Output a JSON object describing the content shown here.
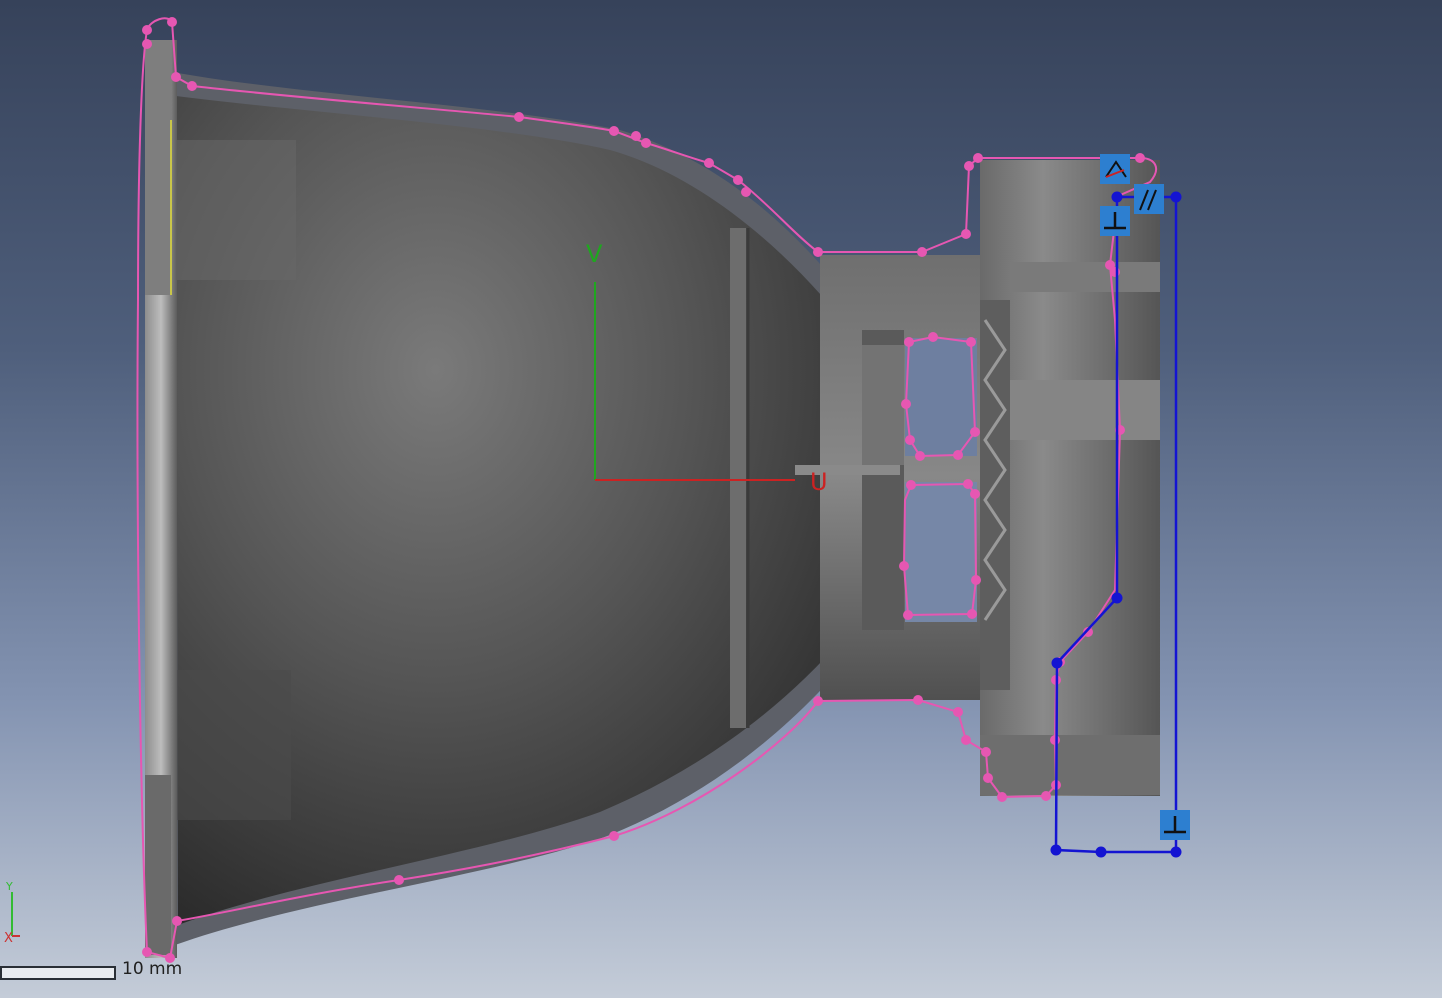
{
  "sketch_axes": {
    "v_label": "V",
    "u_label": "U"
  },
  "triad": {
    "y_label": "Y",
    "x_label": "X"
  },
  "scale_bar": {
    "label": "10 mm"
  },
  "constraint_icons": [
    {
      "name": "angle-constraint-icon",
      "glyph": "∠"
    },
    {
      "name": "parallel-constraint-icon",
      "glyph": "∥"
    },
    {
      "name": "perpendicular-constraint-icon-top",
      "glyph": "⊥"
    },
    {
      "name": "perpendicular-constraint-icon-bottom",
      "glyph": "⊥"
    }
  ],
  "colors": {
    "sketch_profile": "#e657b2",
    "active_sketch": "#1414d2",
    "constraint_badge": "#2d7fd0",
    "v_axis": "#1fa71f",
    "u_axis": "#cc2222",
    "viewport_top": "#36425a",
    "viewport_bottom": "#c4ccd8"
  }
}
